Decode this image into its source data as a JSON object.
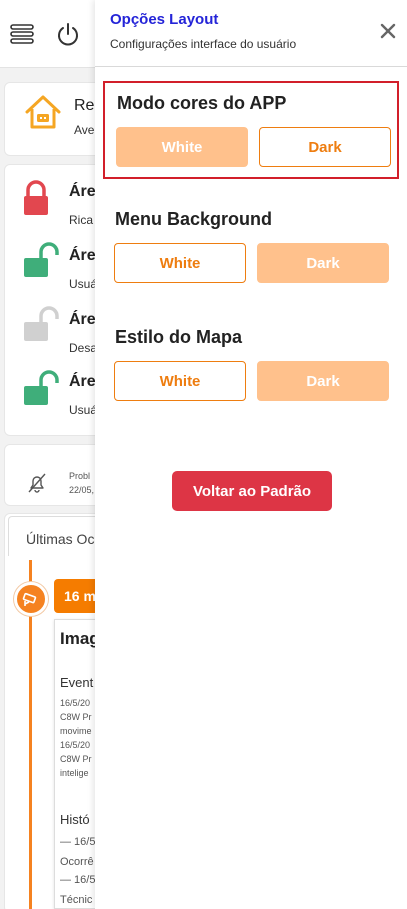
{
  "background": {
    "home_card": {
      "title": "Res",
      "subtitle": "Ave"
    },
    "areas": [
      {
        "title": "Áre",
        "subtitle": "Rica",
        "lock_state": "locked",
        "color": "#e2474f"
      },
      {
        "title": "Áre",
        "subtitle": "Usuá",
        "lock_state": "unlocked",
        "color": "#3fae7a"
      },
      {
        "title": "Áre",
        "subtitle": "Desa",
        "lock_state": "unlocked",
        "color": "#d0d0d0"
      },
      {
        "title": "Áre",
        "subtitle": "Usuá",
        "lock_state": "unlocked",
        "color": "#3fae7a"
      }
    ],
    "notification": {
      "line1": "Probl",
      "line2": "22/05,"
    },
    "occurrences": {
      "tab_label": "Últimas Oc",
      "badge_text": "16 m",
      "panel_title": "Imag",
      "event_heading": "Event",
      "event_lines": [
        "16/5/20",
        "C8W Pr",
        "movime",
        "16/5/20",
        "C8W Pr",
        "intelige"
      ],
      "history_heading": "Histó",
      "history_lines": [
        "— 16/5",
        "Ocorrê",
        "— 16/5",
        "Técnic"
      ]
    }
  },
  "drawer": {
    "title": "Opções Layout",
    "subtitle": "Configurações interface do usuário",
    "sections": [
      {
        "label": "Modo cores do APP",
        "options": [
          "White",
          "Dark"
        ],
        "selected": "Dark",
        "highlighted": true
      },
      {
        "label": "Menu Background",
        "options": [
          "White",
          "Dark"
        ],
        "selected": "White",
        "highlighted": false
      },
      {
        "label": "Estilo do Mapa",
        "options": [
          "White",
          "Dark"
        ],
        "selected": "White",
        "highlighted": false
      }
    ],
    "reset_label": "Voltar ao Padrão"
  },
  "colors": {
    "accent": "#ee7d10",
    "accent_light": "#ffc18c",
    "title_blue": "#2424d8",
    "danger": "#dd3545",
    "highlight_border": "#d21f2a"
  }
}
